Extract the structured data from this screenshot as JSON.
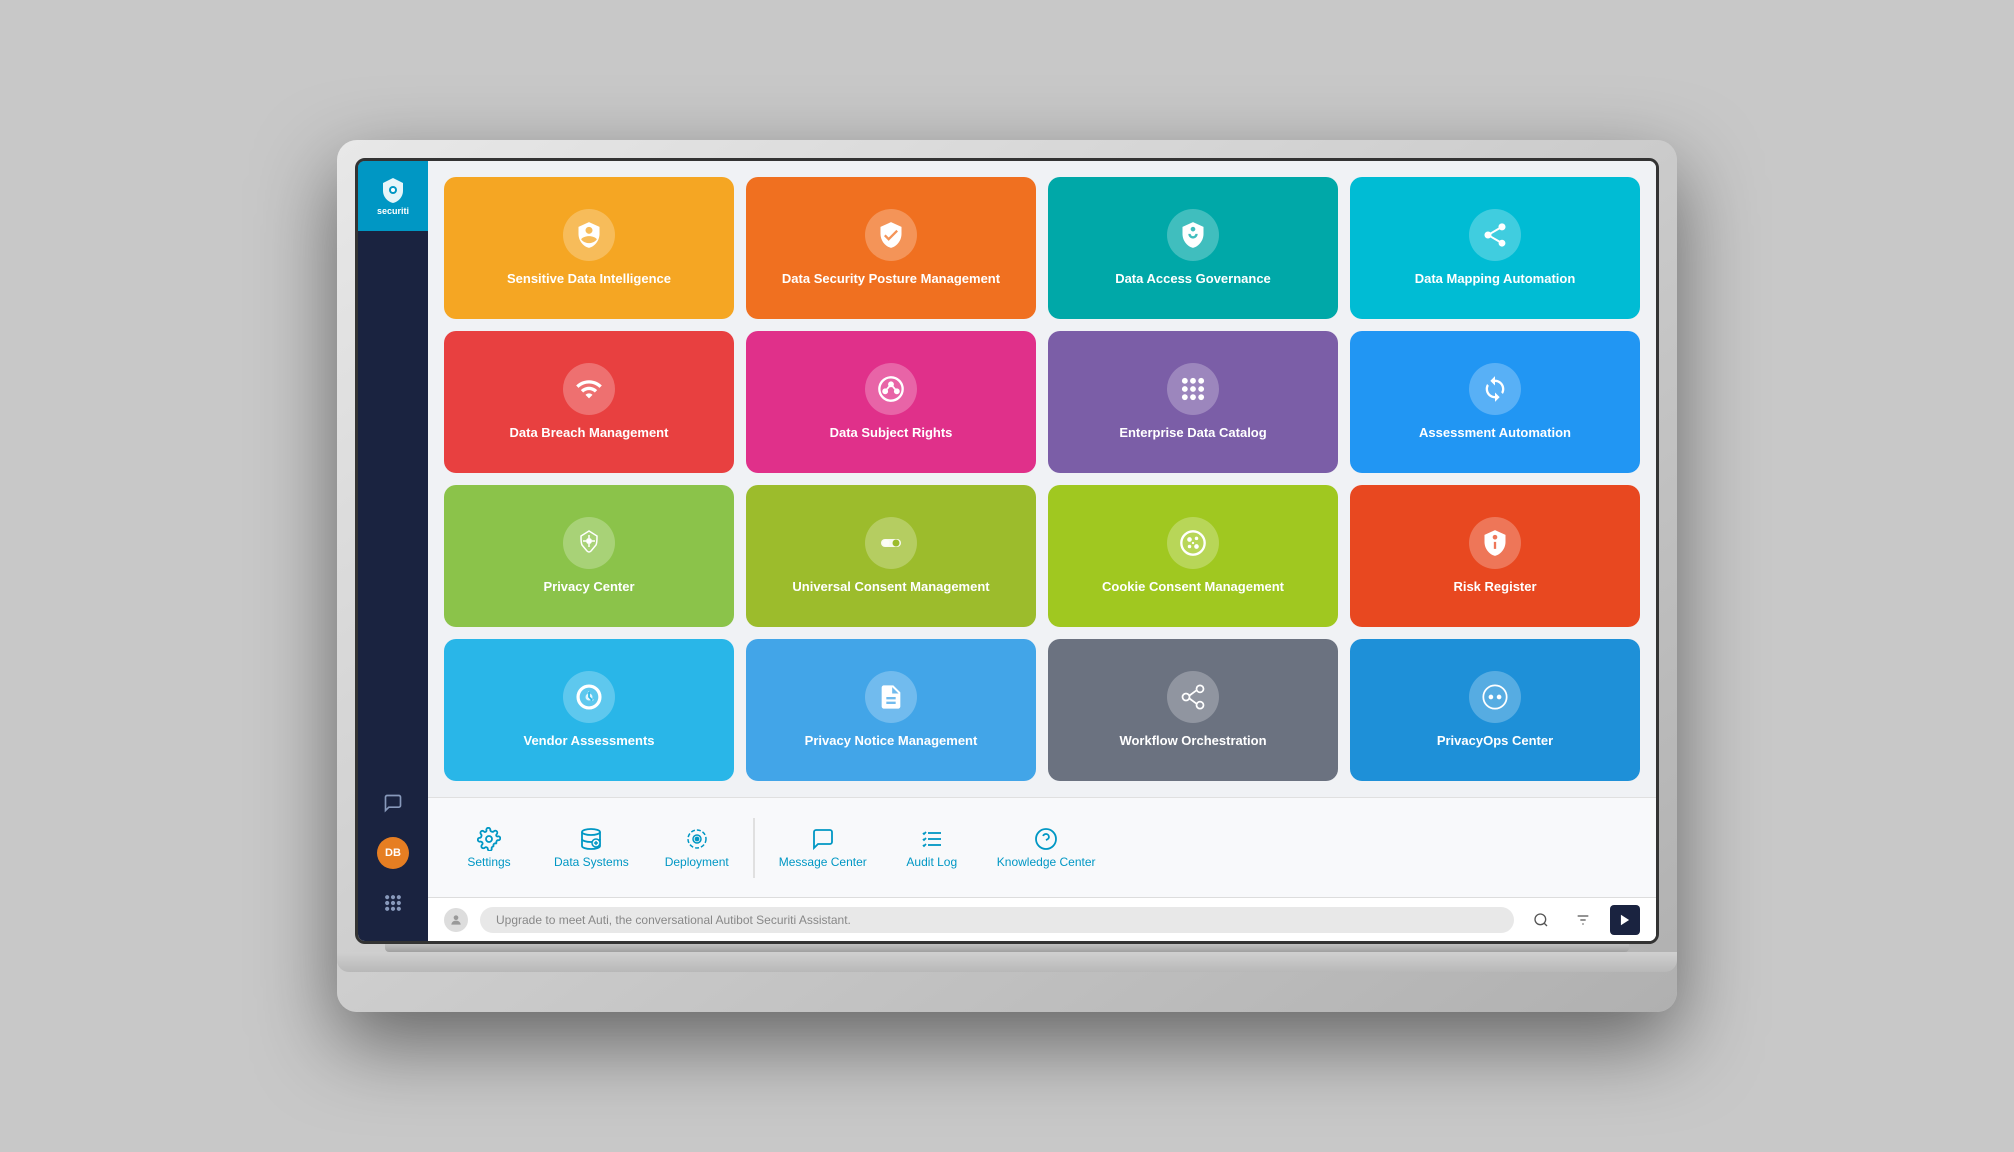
{
  "app": {
    "name": "securiti",
    "tagline": "securiti"
  },
  "sidebar": {
    "logo_label": "securiti",
    "bottom_icons": [
      {
        "name": "chat-icon",
        "symbol": "💬"
      },
      {
        "name": "user-avatar",
        "initials": "DB"
      },
      {
        "name": "grid-icon",
        "symbol": "⠿"
      }
    ]
  },
  "tiles": [
    {
      "id": "sensitive-data-intelligence",
      "label": "Sensitive Data Intelligence",
      "color": "orange",
      "icon": "shield-scan"
    },
    {
      "id": "data-security-posture-management",
      "label": "Data Security Posture Management",
      "color": "orange2",
      "icon": "shield-check"
    },
    {
      "id": "data-access-governance",
      "label": "Data Access Governance",
      "color": "teal",
      "icon": "shield-key"
    },
    {
      "id": "data-mapping-automation",
      "label": "Data Mapping Automation",
      "color": "cyan",
      "icon": "share-nodes"
    },
    {
      "id": "data-breach-management",
      "label": "Data Breach Management",
      "color": "red",
      "icon": "wifi-alert"
    },
    {
      "id": "data-subject-rights",
      "label": "Data Subject Rights",
      "color": "pink",
      "icon": "circle-nodes"
    },
    {
      "id": "enterprise-data-catalog",
      "label": "Enterprise Data Catalog",
      "color": "purple",
      "icon": "grid-circles"
    },
    {
      "id": "assessment-automation",
      "label": "Assessment Automation",
      "color": "blue",
      "icon": "circle-refresh"
    },
    {
      "id": "privacy-center",
      "label": "Privacy Center",
      "color": "green",
      "icon": "hexagon-nodes"
    },
    {
      "id": "universal-consent-management",
      "label": "Universal Consent Management",
      "color": "olive",
      "icon": "toggle-switch"
    },
    {
      "id": "cookie-consent-management",
      "label": "Cookie Consent Management",
      "color": "lgreen",
      "icon": "cookie-circle"
    },
    {
      "id": "risk-register",
      "label": "Risk Register",
      "color": "tomato",
      "icon": "shield-alert"
    },
    {
      "id": "vendor-assessments",
      "label": "Vendor Assessments",
      "color": "skyblue",
      "icon": "settings-circle"
    },
    {
      "id": "privacy-notice-management",
      "label": "Privacy Notice Management",
      "color": "lightblue",
      "icon": "document-lines"
    },
    {
      "id": "workflow-orchestration",
      "label": "Workflow Orchestration",
      "color": "gray",
      "icon": "git-branch"
    },
    {
      "id": "privacyops-center",
      "label": "PrivacyOps Center",
      "color": "azure",
      "icon": "eyes-circle"
    }
  ],
  "utility_items": [
    {
      "id": "settings",
      "label": "Settings",
      "icon": "gear"
    },
    {
      "id": "data-systems",
      "label": "Data Systems",
      "icon": "database-search"
    },
    {
      "id": "deployment",
      "label": "Deployment",
      "icon": "deploy-circle"
    }
  ],
  "utility_items2": [
    {
      "id": "message-center",
      "label": "Message Center",
      "icon": "chat-square"
    },
    {
      "id": "audit-log",
      "label": "Audit Log",
      "icon": "list-check"
    },
    {
      "id": "knowledge-center",
      "label": "Knowledge Center",
      "icon": "question-circle"
    }
  ],
  "bottom_bar": {
    "chat_placeholder": "Upgrade to meet Auti, the conversational Autibot Securiti Assistant."
  }
}
